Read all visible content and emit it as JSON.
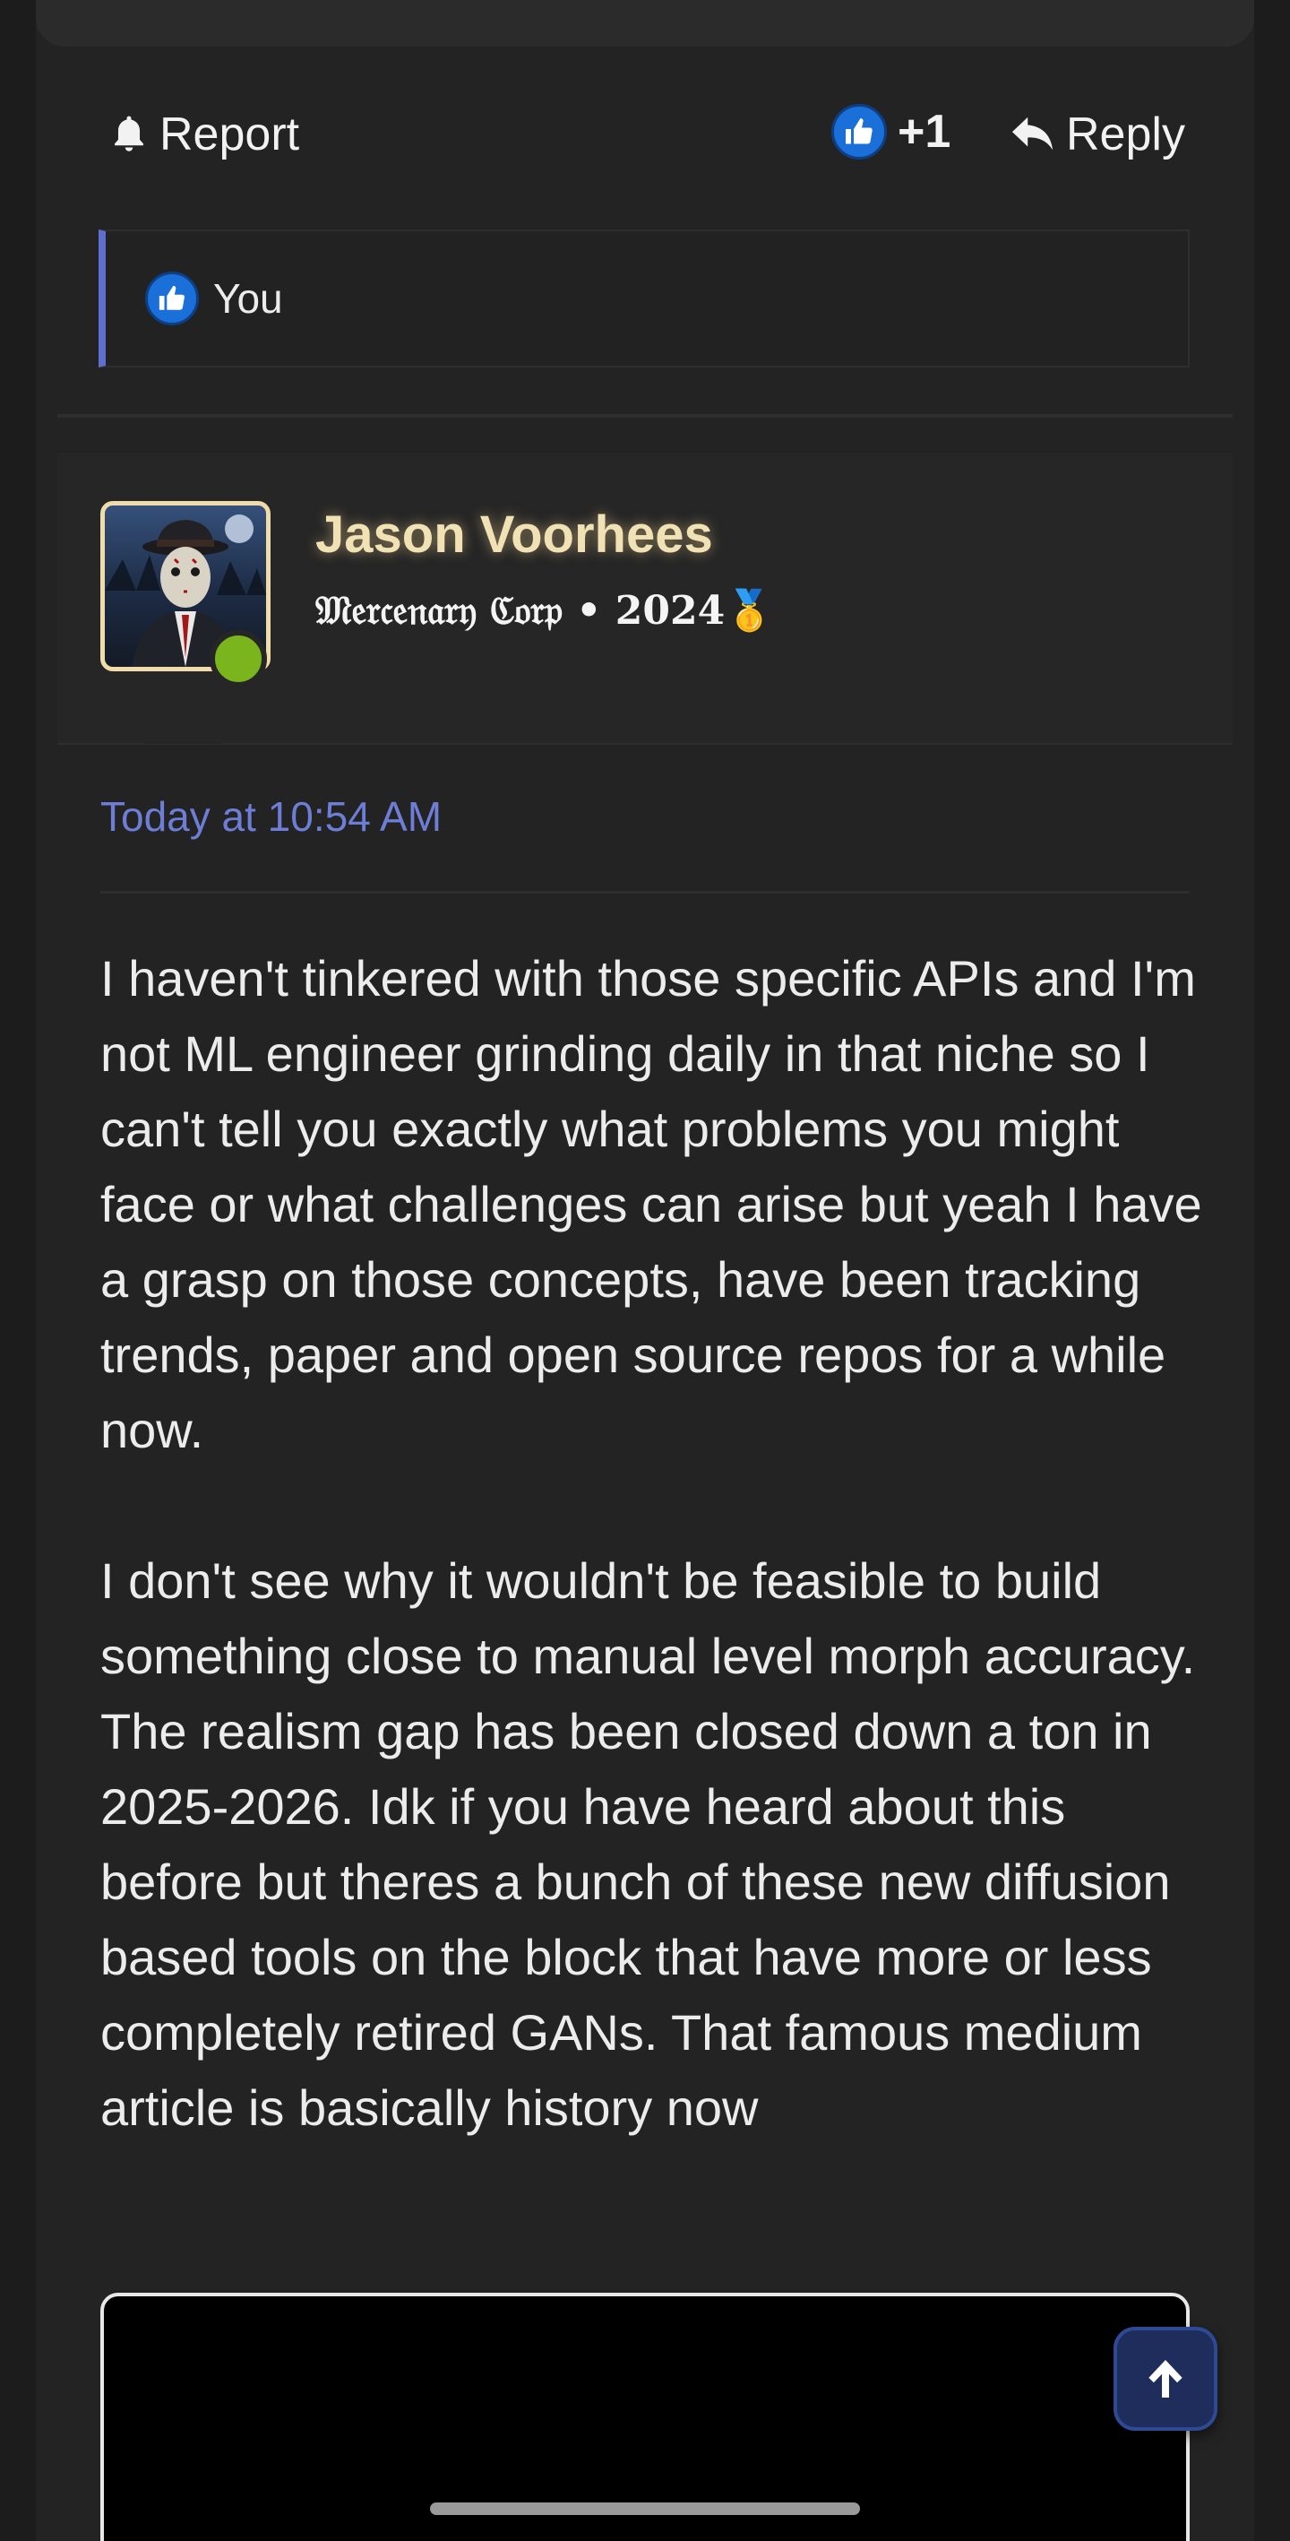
{
  "actions": {
    "report_label": "Report",
    "like_count": "+1",
    "reply_label": "Reply"
  },
  "reactions": {
    "users_label": "You"
  },
  "post": {
    "username": "Jason Voorhees",
    "user_title": "𝔐𝔢𝔯𝔠𝔢𝔫𝔞𝔯𝔶 ℭ𝔬𝔯𝔭 • 2024🥇",
    "timestamp": "Today at 10:54 AM",
    "paragraphs": [
      "I haven't tinkered with those specific APIs and I'm not ML engineer grinding daily in that niche so I can't tell you exactly what problems you might face or what challenges can arise but yeah I have a grasp on those concepts, have been tracking trends, paper and open source repos for a while now.",
      "I don't see why it wouldn't be feasible to build something close to manual level morph accuracy. The realism gap has been closed down a ton in 2025-2026. Idk if you have heard about this before but theres a bunch of these new diffusion based tools on the block that have more or less completely retired GANs. That famous medium article is basically history now"
    ]
  },
  "colors": {
    "accent": "#5f6fce",
    "timestamp": "#6e7ed6",
    "username": "#f1e2b5",
    "online": "#7ab51d",
    "like": "#1a6fd8"
  },
  "icons": {
    "report": "bell-icon",
    "like": "thumbs-up-icon",
    "reply": "reply-arrow-icon",
    "scroll_top": "arrow-up-icon"
  }
}
